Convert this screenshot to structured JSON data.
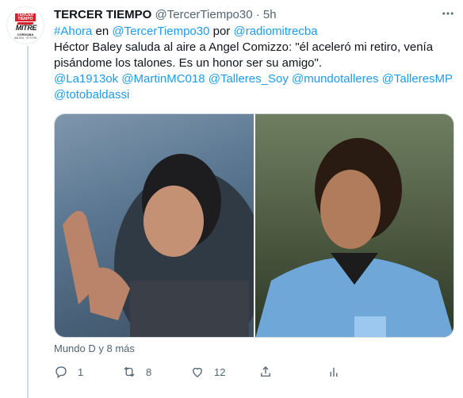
{
  "tweet": {
    "author_name": "TERCER TIEMPO",
    "handle": "@TercerTiempo30",
    "separator": "·",
    "time": "5h",
    "text": {
      "hashtag": "#Ahora",
      "word_en": " en ",
      "mention_account": "@TercerTiempo30",
      "word_por": " por ",
      "mention_radio": "@radiomitrecba",
      "body": "Héctor Baley saluda al aire a Angel Comizzo: \"él aceleró mi retiro, venía pisándome los talones. Es un honor ser su amigo\".",
      "mentions": [
        "@La1913ok",
        "@MartinMC018",
        "@Talleres_Soy",
        "@mundotalleres",
        "@TalleresMP",
        "@totobaldassi"
      ]
    },
    "reply_context": "Mundo D y 8 más",
    "avatar": {
      "top_text": "TERCER TIEMPO",
      "brand": "MITRE",
      "city": "CÓRDOBA",
      "freq": "AM 810 · 97.9 FM"
    }
  },
  "actions": {
    "reply_count": "1",
    "retweet_count": "8",
    "like_count": "12",
    "share_label": "",
    "analytics_label": ""
  },
  "colors": {
    "link": "#1d9bf0",
    "muted": "#536471",
    "brand_red": "#d6202b"
  },
  "icons": [
    "more-icon",
    "reply-icon",
    "retweet-icon",
    "like-icon",
    "share-icon",
    "analytics-icon"
  ]
}
